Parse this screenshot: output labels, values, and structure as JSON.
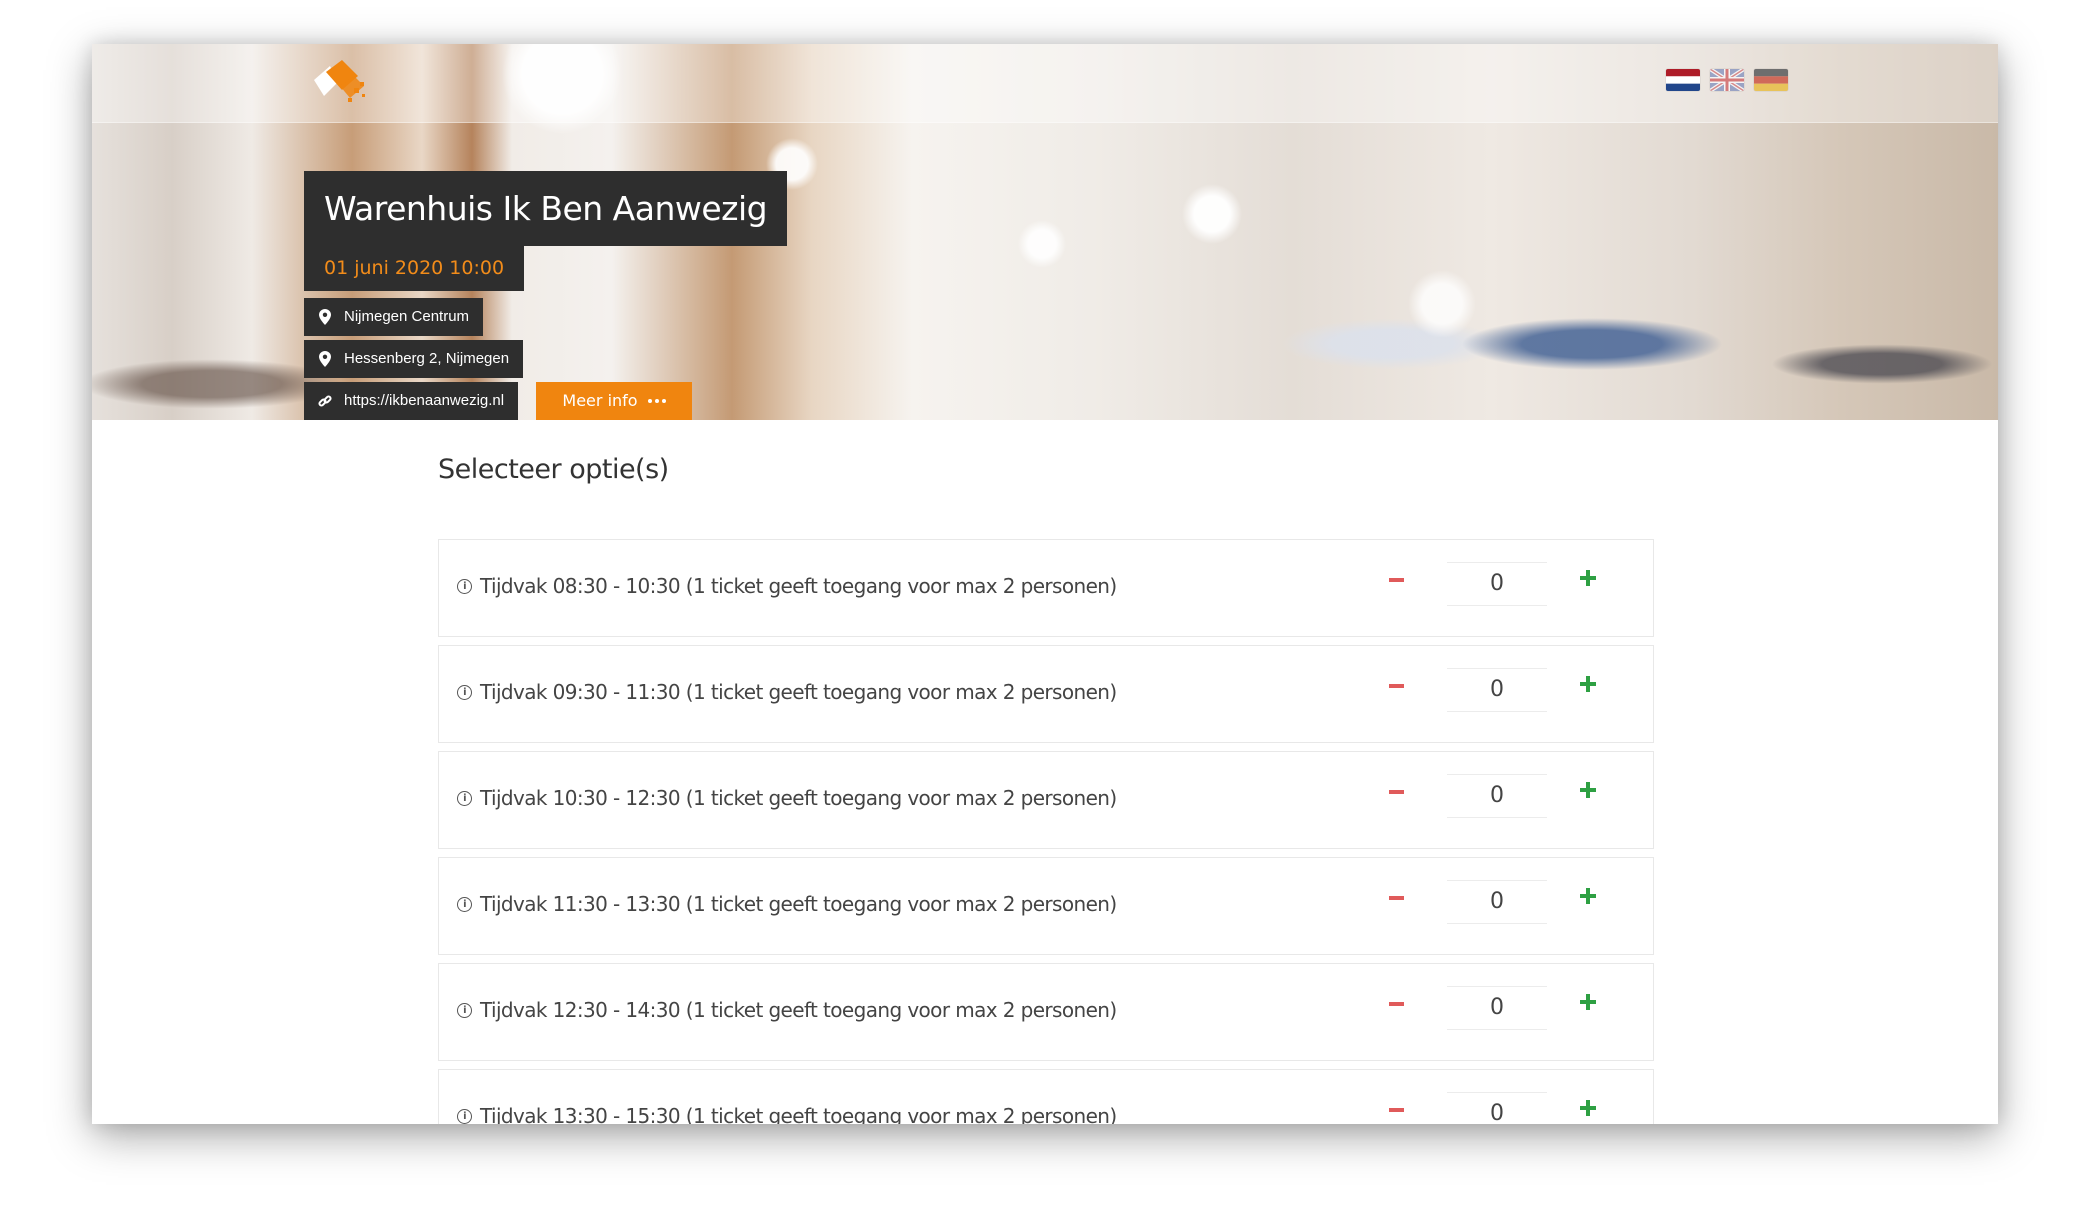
{
  "event": {
    "title": "Warenhuis Ik Ben Aanwezig",
    "datetime": "01 juni 2020 10:00",
    "location": "Nijmegen Centrum",
    "address": "Hessenberg 2, Nijmegen",
    "website": "https://ikbenaanwezig.nl",
    "more_info_label": "Meer info"
  },
  "languages": [
    {
      "code": "nl",
      "icon": "flag-nl-icon"
    },
    {
      "code": "en",
      "icon": "flag-uk-icon"
    },
    {
      "code": "de",
      "icon": "flag-de-icon"
    }
  ],
  "section_title": "Selecteer optie(s)",
  "options": [
    {
      "label": "Tijdvak 08:30 - 10:30 (1 ticket geeft toegang voor max 2 personen)",
      "quantity": "0"
    },
    {
      "label": "Tijdvak 09:30 - 11:30 (1 ticket geeft toegang voor max 2 personen)",
      "quantity": "0"
    },
    {
      "label": "Tijdvak 10:30 - 12:30 (1 ticket geeft toegang voor max 2 personen)",
      "quantity": "0"
    },
    {
      "label": "Tijdvak 11:30 - 13:30 (1 ticket geeft toegang voor max 2 personen)",
      "quantity": "0"
    },
    {
      "label": "Tijdvak 12:30 - 14:30 (1 ticket geeft toegang voor max 2 personen)",
      "quantity": "0"
    },
    {
      "label": "Tijdvak 13:30 - 15:30 (1 ticket geeft toegang voor max 2 personen)",
      "quantity": "0"
    }
  ],
  "colors": {
    "accent": "#f0850f",
    "minus": "#e05a5a",
    "plus": "#2ea043",
    "dark_box": "#2e2e2e"
  }
}
